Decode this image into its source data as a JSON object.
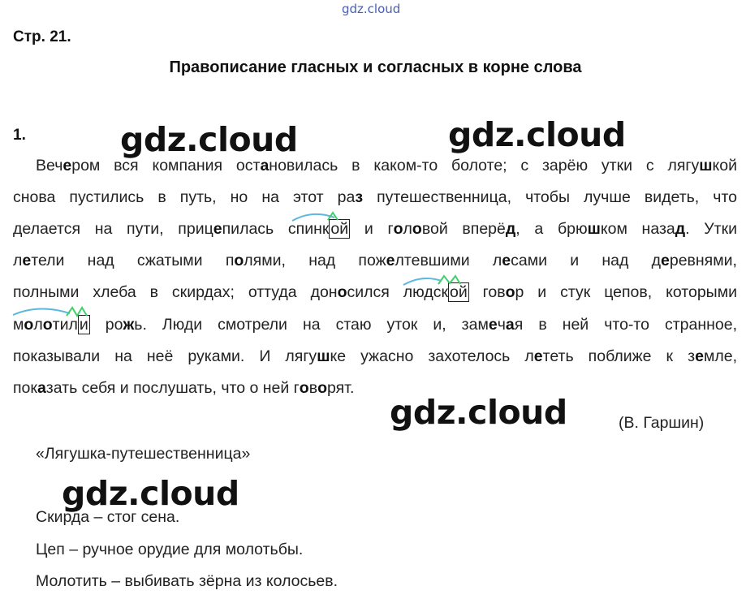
{
  "header": {
    "watermark_top": "gdz.cloud",
    "page_number": "Стр. 21.",
    "section_title": "Правописание гласных и согласных в корне слова"
  },
  "task": {
    "number": "1."
  },
  "watermarks": [
    "gdz.cloud",
    "gdz.cloud",
    "gdz.cloud",
    "gdz.cloud"
  ],
  "text_lines": [
    [
      {
        "t": "Веч"
      },
      {
        "t": "е",
        "b": 1
      },
      {
        "t": "ром вся компания ост"
      },
      {
        "t": "а",
        "b": 1
      },
      {
        "t": "новилась в каком-то болоте; с зарёю утки с лягу"
      },
      {
        "t": "ш",
        "b": 1
      },
      {
        "t": "кой"
      }
    ],
    [
      {
        "t": "снова пустились в путь, но на этот ра"
      },
      {
        "t": "з",
        "b": 1
      },
      {
        "t": " путешественница, чтобы лучше видеть, что"
      }
    ],
    [
      {
        "t": "делается на пути, приц"
      },
      {
        "t": "е",
        "b": 1
      },
      {
        "t": "пилась спинк"
      },
      {
        "t": "ой",
        "box": 1
      },
      {
        "t": " и г"
      },
      {
        "t": "о",
        "b": 1
      },
      {
        "t": "л"
      },
      {
        "t": "о",
        "b": 1
      },
      {
        "t": "вой вперё"
      },
      {
        "t": "д",
        "b": 1
      },
      {
        "t": ", а брю"
      },
      {
        "t": "ш",
        "b": 1
      },
      {
        "t": "ком наза"
      },
      {
        "t": "д",
        "b": 1
      },
      {
        "t": ". Утки"
      }
    ],
    [
      {
        "t": "л"
      },
      {
        "t": "е",
        "b": 1
      },
      {
        "t": "тели над сжатыми п"
      },
      {
        "t": "о",
        "b": 1
      },
      {
        "t": "лями, над пож"
      },
      {
        "t": "е",
        "b": 1
      },
      {
        "t": "лтевшими л"
      },
      {
        "t": "е",
        "b": 1
      },
      {
        "t": "сами и над д"
      },
      {
        "t": "е",
        "b": 1
      },
      {
        "t": "ревнями,"
      }
    ],
    [
      {
        "t": "полными хлеба в скирдах; оттуда дон"
      },
      {
        "t": "о",
        "b": 1
      },
      {
        "t": "сился людск"
      },
      {
        "t": "ой",
        "box": 1
      },
      {
        "t": " гов"
      },
      {
        "t": "о",
        "b": 1
      },
      {
        "t": "р и стук цепов, которыми"
      }
    ],
    [
      {
        "t": "м"
      },
      {
        "t": "о",
        "b": 1
      },
      {
        "t": "л"
      },
      {
        "t": "о",
        "b": 1
      },
      {
        "t": "тил"
      },
      {
        "t": "и",
        "box": 1
      },
      {
        "t": " ро"
      },
      {
        "t": "ж",
        "b": 1
      },
      {
        "t": "ь. Люди смотрели на стаю уток и, зам"
      },
      {
        "t": "е",
        "b": 1
      },
      {
        "t": "ч"
      },
      {
        "t": "а",
        "b": 1
      },
      {
        "t": "я в ней что-то странное,"
      }
    ],
    [
      {
        "t": "показывали на неё руками. И лягу"
      },
      {
        "t": "ш",
        "b": 1
      },
      {
        "t": "ке ужасно захотелось л"
      },
      {
        "t": "е",
        "b": 1
      },
      {
        "t": "теть поближе к з"
      },
      {
        "t": "е",
        "b": 1
      },
      {
        "t": "мле,"
      }
    ],
    [
      {
        "t": "пок"
      },
      {
        "t": "а",
        "b": 1
      },
      {
        "t": "зать себя и послушать, что о ней г"
      },
      {
        "t": "о",
        "b": 1
      },
      {
        "t": "в"
      },
      {
        "t": "о",
        "b": 1
      },
      {
        "t": "рят."
      }
    ]
  ],
  "author": "(В. Гаршин)",
  "source_title": "«Лягушка-путешественница»",
  "glossary": [
    "Скирда – стог сена.",
    "Цеп – ручное орудие для молотьбы.",
    "Молотить – выбивать зёрна из колосьев."
  ],
  "colors": {
    "mark_blue": "#5bb8e0",
    "mark_green": "#3fd06a",
    "link_blue": "#4a5fb0"
  }
}
